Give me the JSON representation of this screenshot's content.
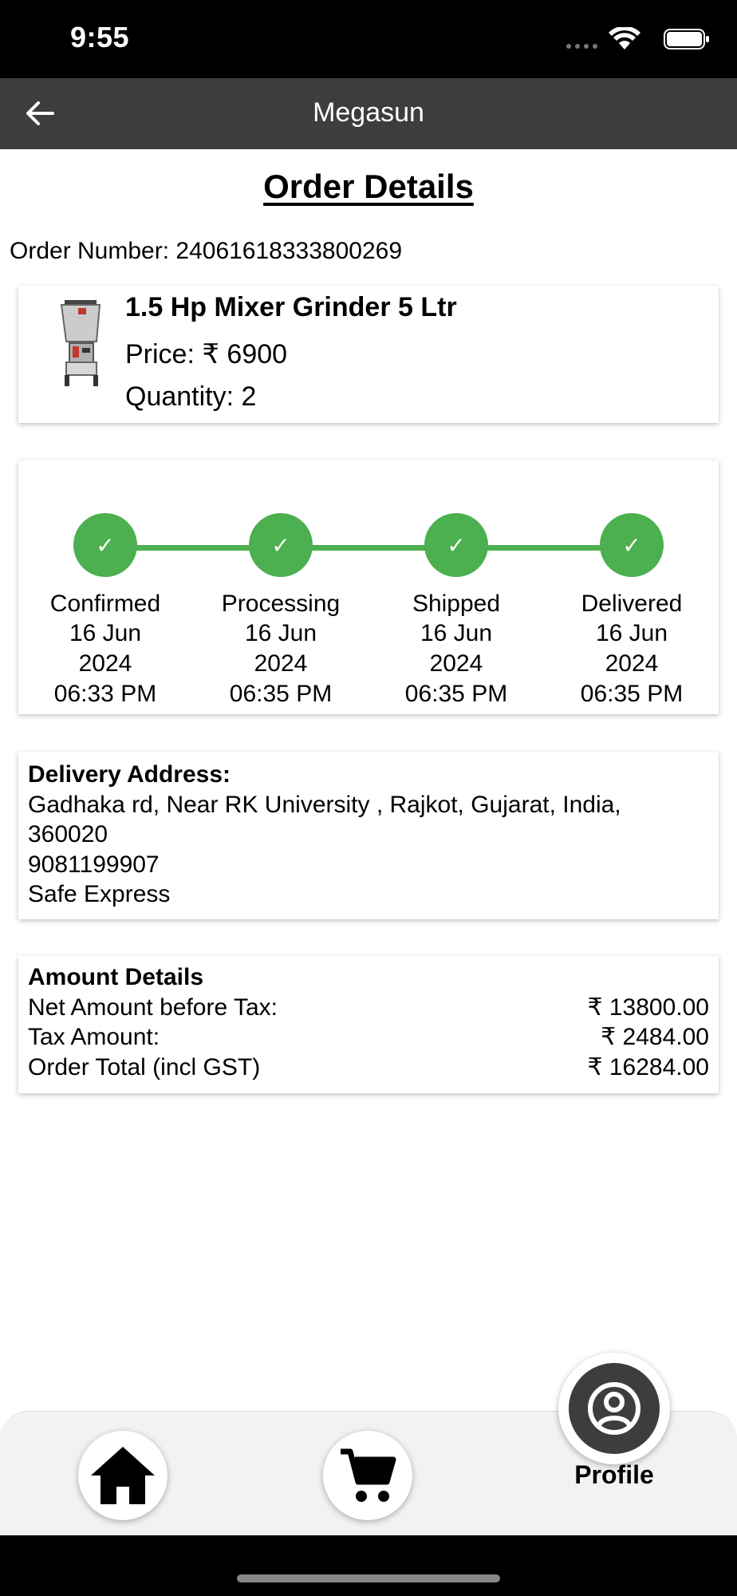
{
  "status_bar": {
    "time": "9:55"
  },
  "app_bar": {
    "title": "Megasun"
  },
  "page": {
    "title": "Order Details",
    "order_number": "Order Number: 24061618333800269"
  },
  "product": {
    "name": "1.5 Hp Mixer Grinder 5 Ltr",
    "price": "Price: ₹ 6900",
    "quantity": "Quantity: 2"
  },
  "tracker": {
    "steps": [
      {
        "label": "Confirmed",
        "date": "16 Jun",
        "year": "2024",
        "time": "06:33 PM"
      },
      {
        "label": "Processing",
        "date": "16 Jun",
        "year": "2024",
        "time": "06:35 PM"
      },
      {
        "label": "Shipped",
        "date": "16 Jun",
        "year": "2024",
        "time": "06:35 PM"
      },
      {
        "label": "Delivered",
        "date": "16 Jun",
        "year": "2024",
        "time": "06:35 PM"
      }
    ],
    "check_glyph": "✓",
    "color": "#4caf50"
  },
  "address": {
    "heading": "Delivery Address:",
    "line1": "Gadhaka rd, Near RK University , Rajkot, Gujarat, India,",
    "line2": "360020",
    "phone": "9081199907",
    "courier": "Safe Express"
  },
  "amount": {
    "heading": "Amount Details",
    "rows": [
      {
        "label": "Net Amount before Tax:",
        "value": "₹ 13800.00"
      },
      {
        "label": "Tax Amount:",
        "value": "₹ 2484.00"
      },
      {
        "label": "Order Total (incl GST)",
        "value": "₹ 16284.00"
      }
    ]
  },
  "nav": {
    "home_icon": "home-icon",
    "cart_icon": "cart-icon",
    "profile_label": "Profile"
  }
}
